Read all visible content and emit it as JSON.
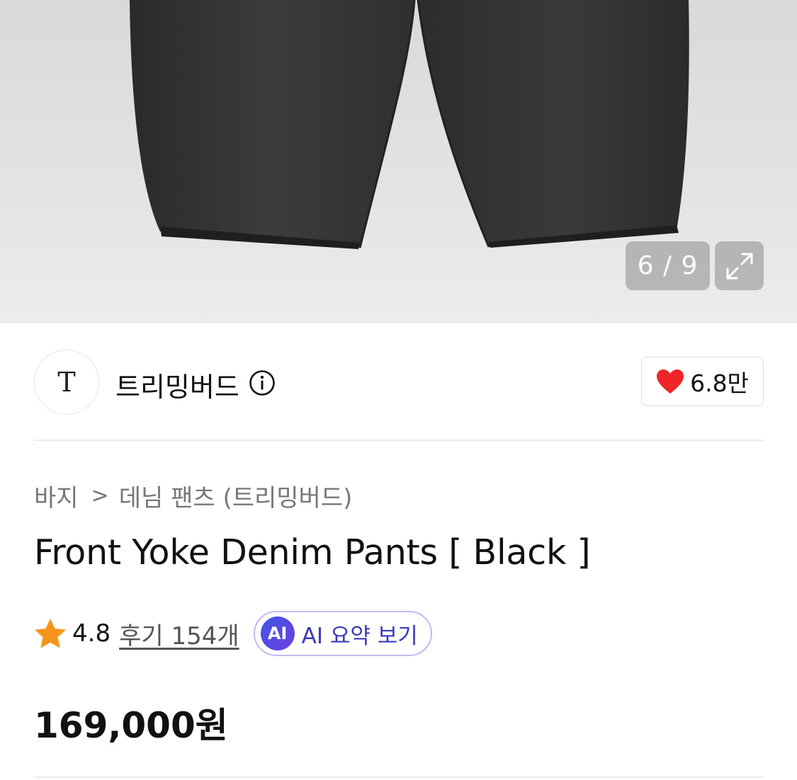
{
  "gallery": {
    "counter": "6 / 9"
  },
  "brand": {
    "logo_letter": "T",
    "name": "트리밍버드",
    "likes": "6.8만"
  },
  "product": {
    "breadcrumb": [
      "바지",
      "데님 팬츠 (트리밍버드)"
    ],
    "title": "Front Yoke Denim Pants [ Black ]",
    "rating": "4.8",
    "review_link": "후기 154개",
    "ai_badge": "AI",
    "ai_summary_label": "AI 요약 보기",
    "price": "169,000원"
  },
  "colors": {
    "heart": "#f0252a",
    "star": "#f7941d",
    "ai_text": "#3a3ab8"
  },
  "icons": {
    "info": "info-icon",
    "heart": "heart-icon",
    "star": "star-icon",
    "expand": "expand-icon"
  }
}
